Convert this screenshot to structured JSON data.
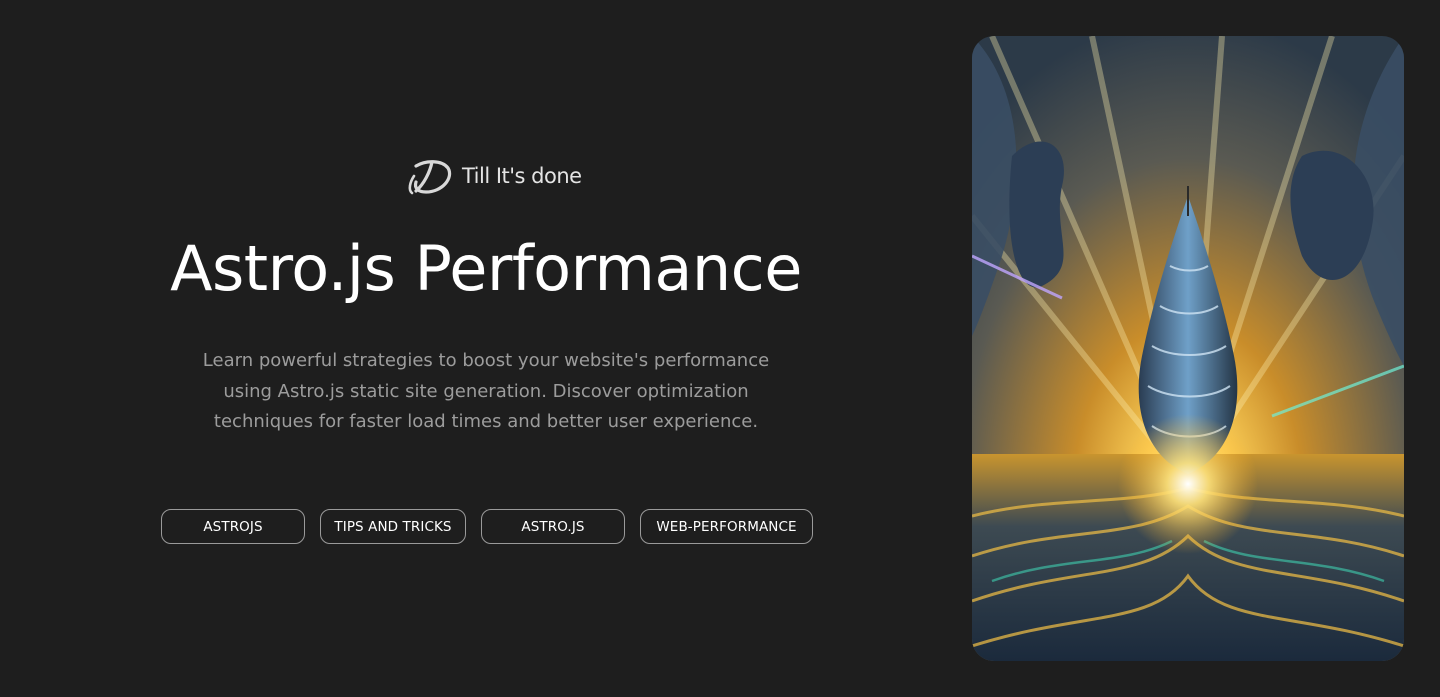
{
  "brand": {
    "name": "Till It's done",
    "logo_icon": "brand-logo-icon"
  },
  "hero": {
    "title": "Astro.js Performance",
    "description": "Learn powerful strategies to boost your website's performance using Astro.js static site generation. Discover optimization techniques for faster load times and better user experience.",
    "tags": [
      "ASTROJS",
      "TIPS AND TRICKS",
      "ASTRO.JS",
      "WEB-PERFORMANCE"
    ]
  },
  "image": {
    "alt": "Surreal golden sunset with spiraling tower and ocean waves"
  },
  "colors": {
    "background": "#1e1e1e",
    "title": "#ffffff",
    "description": "#9c9c9c",
    "tag_border": "#9a9a9a"
  }
}
